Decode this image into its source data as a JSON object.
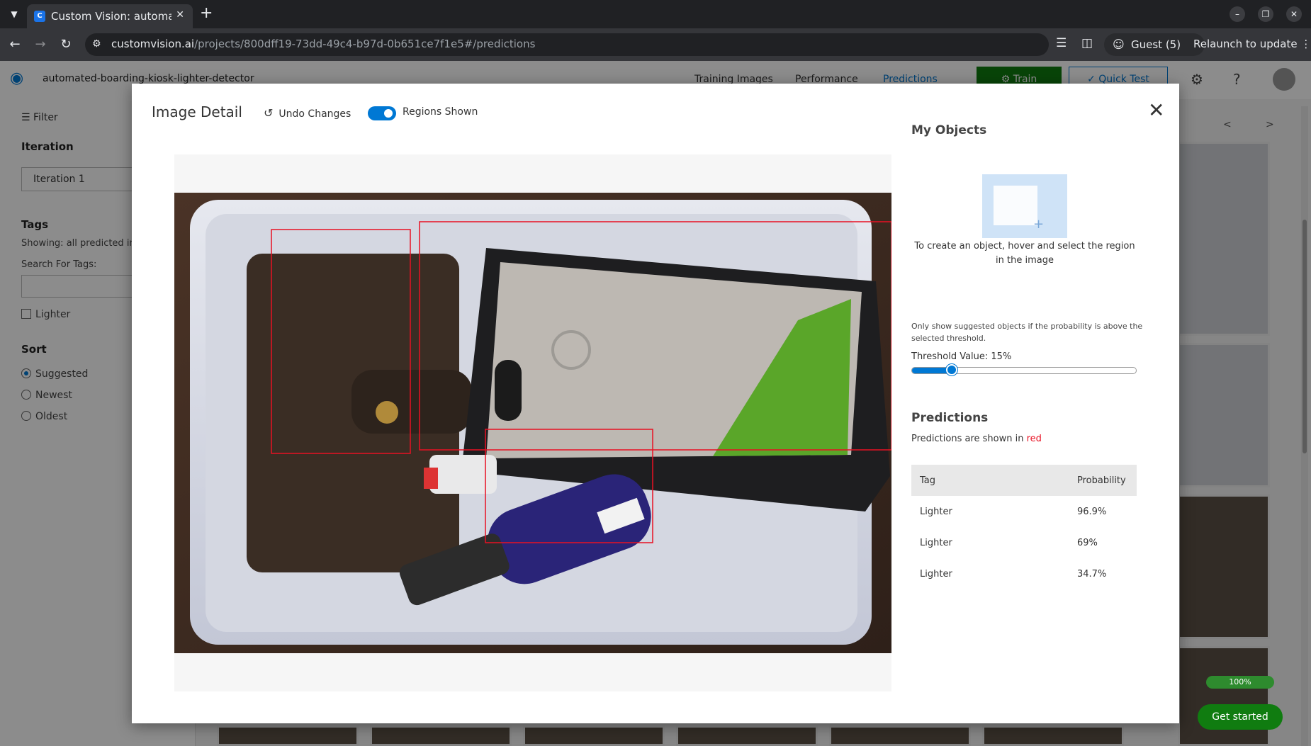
{
  "browser": {
    "tab_title": "Custom Vision: automat",
    "url_host": "customvision.ai",
    "url_path": "/projects/800dff19-73dd-49c4-b97d-0b651ce7f1e5#/predictions",
    "guest_label": "Guest (5)",
    "relaunch_label": "Relaunch to update"
  },
  "app": {
    "project_name": "automated-boarding-kiosk-lighter-detector",
    "nav": [
      "Training Images",
      "Performance",
      "Predictions"
    ],
    "train_label": "Train",
    "quick_test_label": "Quick Test"
  },
  "left_panel": {
    "filter_label": "Filter",
    "iteration_heading": "Iteration",
    "iteration_value": "Iteration 1",
    "tags_heading": "Tags",
    "tags_showing": "Showing: all predicted im",
    "search_label": "Search For Tags:",
    "tag_checkbox": "Lighter",
    "sort_heading": "Sort",
    "sort_options": [
      "Suggested",
      "Newest",
      "Oldest"
    ]
  },
  "background": {
    "pager_prev": "<",
    "pager_next": ">",
    "progress": "100%",
    "get_started": "Get started"
  },
  "modal": {
    "title": "Image Detail",
    "undo_label": "Undo Changes",
    "regions_label": "Regions Shown",
    "regions_shown": true,
    "my_objects_heading": "My Objects",
    "create_hint": "To create an object, hover and select the region in the image",
    "threshold_hint": "Only show suggested objects if the probability is above the selected threshold.",
    "threshold_label": "Threshold Value: 15%",
    "threshold_value": 15,
    "predictions_heading": "Predictions",
    "predictions_note_prefix": "Predictions are shown in",
    "predictions_note_color": "red",
    "table_headers": [
      "Tag",
      "Probability"
    ],
    "predictions": [
      {
        "tag": "Lighter",
        "probability": "96.9%"
      },
      {
        "tag": "Lighter",
        "probability": "69%"
      },
      {
        "tag": "Lighter",
        "probability": "34.7%"
      }
    ]
  },
  "colors": {
    "accent": "#0078d4",
    "train_green": "#107c10",
    "region_red": "#e81123"
  }
}
